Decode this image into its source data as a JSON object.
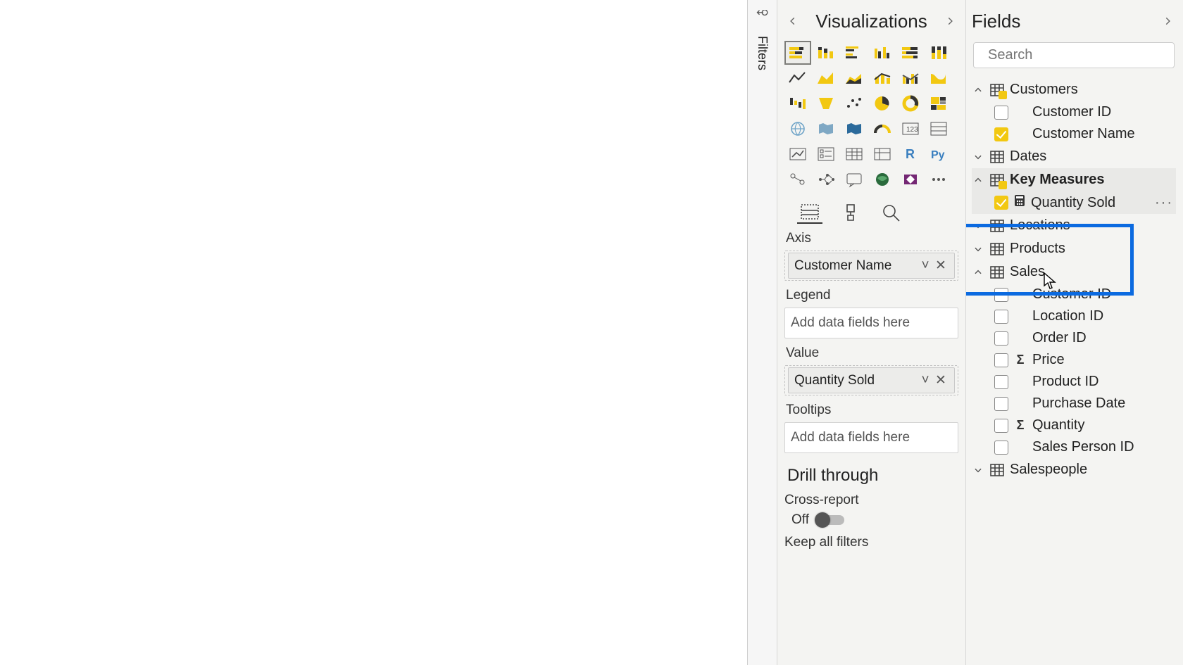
{
  "filters": {
    "label": "Filters"
  },
  "viz": {
    "title": "Visualizations",
    "wells": {
      "axis_label": "Axis",
      "axis_field": "Customer Name",
      "legend_label": "Legend",
      "legend_placeholder": "Add data fields here",
      "value_label": "Value",
      "value_field": "Quantity Sold",
      "tooltips_label": "Tooltips",
      "tooltips_placeholder": "Add data fields here"
    },
    "drill": {
      "title": "Drill through",
      "cross_label": "Cross-report",
      "cross_state": "Off",
      "keep_label": "Keep all filters"
    }
  },
  "fields": {
    "title": "Fields",
    "search_placeholder": "Search",
    "tables": {
      "customers": {
        "name": "Customers",
        "items": {
          "id": "Customer ID",
          "name": "Customer Name"
        }
      },
      "dates": {
        "name": "Dates"
      },
      "key_measures": {
        "name": "Key Measures",
        "items": {
          "qty": "Quantity Sold"
        }
      },
      "locations": {
        "name": "Locations"
      },
      "products": {
        "name": "Products"
      },
      "sales": {
        "name": "Sales",
        "items": {
          "cust": "Customer ID",
          "loc": "Location ID",
          "order": "Order ID",
          "price": "Price",
          "prod": "Product ID",
          "pdate": "Purchase Date",
          "qty": "Quantity",
          "sp": "Sales Person ID"
        }
      },
      "salespeople": {
        "name": "Salespeople"
      }
    }
  }
}
